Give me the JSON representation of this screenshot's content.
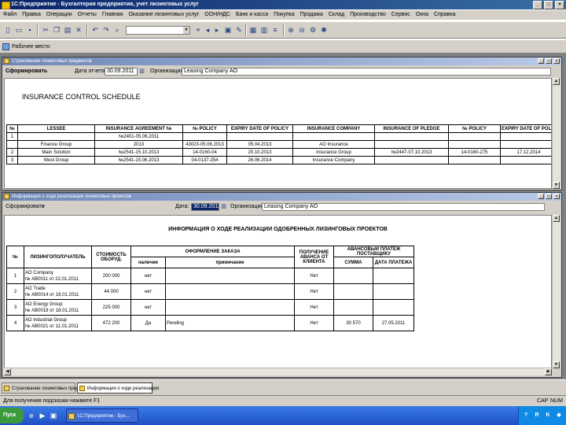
{
  "app": {
    "title": "1С:Предприятие - Бухгалтерия предприятия, учет лизинговых услуг",
    "window_controls": [
      "_",
      "□",
      "×"
    ]
  },
  "menu": [
    "Файл",
    "Правка",
    "Операции",
    "Отчеты",
    "Главная",
    "Оказание лизинговых услуг",
    "ООН/НДС",
    "Банк и касса",
    "Покупка",
    "Продажа",
    "Склад",
    "Производство",
    "Сервис",
    "Окна",
    "Справка"
  ],
  "toolbar2": {
    "workplace_label": "Рабочее место"
  },
  "window1": {
    "title": "Страхование лизинговых предметов",
    "form_button": "Сформировать",
    "date_label": "Дата отчета:",
    "date_value": "30.09.2011",
    "org_label": "Организация:",
    "org_value": "Leasing Company AO",
    "report_title": "INSURANCE CONTROL SCHEDULE",
    "headers": [
      "№",
      "LESSEE",
      "INSURANCE AGREEMENT №",
      "№ POLICY",
      "EXPIRY DATE OF POLICY",
      "INSURANCE COMPANY",
      "INSURANCE OF PLEDGE",
      "№ POLICY",
      "EXPIRY DATE OF POLICY"
    ],
    "rows": [
      [
        "1",
        "",
        "№2401-05.06.2011",
        "",
        "",
        "",
        "",
        "",
        ""
      ],
      [
        "",
        "Finance Group",
        "2013",
        "43023-05.06.2013",
        "05.04.2013",
        "AO Insurance",
        "",
        "",
        ""
      ],
      [
        "2",
        "Main Solution",
        "№2541-15.10.2013",
        "14-0160-04",
        "20.10.2013",
        "Insurance Group",
        "№2447-07.10.2013",
        "14-0160-275",
        "17.12.2014"
      ],
      [
        "3",
        "West Group",
        "№2541-15.06.2013",
        "04-0137-254",
        "26.06.2014",
        "Insurance Company",
        "",
        "",
        ""
      ]
    ]
  },
  "window2": {
    "title": "Информация о ходе реализации лизинговых проектов",
    "form_button": "Сформировать",
    "date_label": "Дата:",
    "date_value": "30.09.2011",
    "org_label": "Организация:",
    "org_value": "Leasing Company AO",
    "report_title": "ИНФОРМАЦИЯ О ХОДЕ РЕАЛИЗАЦИИ ОДОБРЕННЫХ ЛИЗИНГОВЫХ ПРОЕКТОВ",
    "headers": {
      "num": "№",
      "recipient": "ЛИЗИНГОПОЛУЧАТЕЛЬ",
      "cost": "СТОИМОСТЬ ОБОРУД.",
      "order": "ОФОРМЛЕНИЕ ЗАКАЗА",
      "order_sub": [
        "наличие",
        "примечание"
      ],
      "advance": "ПОЛУЧЕНИЕ АВАНСА ОТ КЛИЕНТА",
      "supplier_advance": "АВАНСОВЫЙ ПЛАТЕЖ ПОСТАВЩИКУ",
      "supplier_sub": [
        "СУММА",
        "ДАТА ПЛАТЕЖА"
      ]
    },
    "rows": [
      {
        "num": "1",
        "recipient": [
          "АО Company",
          "№ АВ0011 от 22.01.2011"
        ],
        "cost": "200 000",
        "presence": "нет",
        "note": "",
        "advance": "Нет",
        "sum": "",
        "date": ""
      },
      {
        "num": "2",
        "recipient": [
          "АО Trade",
          "№ АВ0014 от 18.01.2011"
        ],
        "cost": "44 000",
        "presence": "нет",
        "note": "",
        "advance": "Нет",
        "sum": "",
        "date": ""
      },
      {
        "num": "3",
        "recipient": [
          "АО Energy Group",
          "№ АВ0018 от 18.01.2011"
        ],
        "cost": "225 000",
        "presence": "нет",
        "note": "",
        "advance": "Нет",
        "sum": "",
        "date": ""
      },
      {
        "num": "4",
        "recipient": [
          "АО Industrial Group",
          "№ АВ0021 от 11.01.2011"
        ],
        "cost": "472 200",
        "presence": "Да",
        "note": "Pending",
        "advance": "Нет",
        "sum": "30 570",
        "date": "27.05.2011"
      }
    ]
  },
  "window_tabs": [
    "Страхование лизинговых предметов",
    "Информация о ходе реализации"
  ],
  "status": {
    "hint": "Для получения подсказки нажмите F1",
    "caps": "CAP",
    "num": "NUM"
  },
  "taskbar": {
    "start": "Пуск",
    "task": "1С:Предприятие - Бух..."
  }
}
